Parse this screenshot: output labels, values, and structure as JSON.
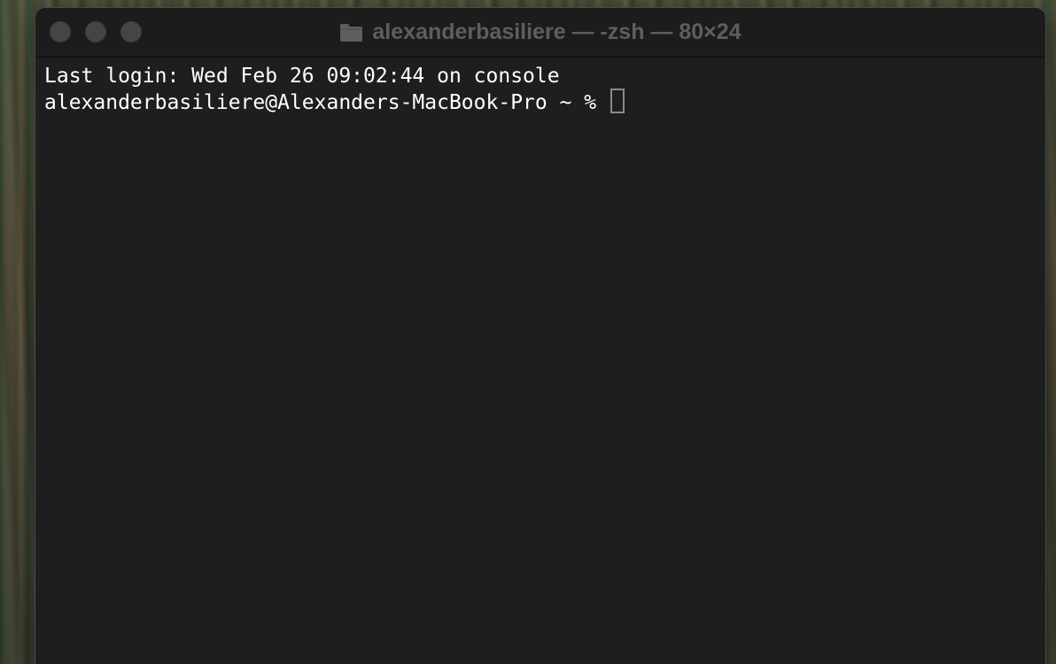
{
  "window": {
    "title": "alexanderbasiliere — -zsh — 80×24",
    "title_icon": "folder-icon",
    "traffic_lights": [
      "close",
      "minimize",
      "zoom"
    ]
  },
  "terminal": {
    "lines": [
      "Last login: Wed Feb 26 09:02:44 on console",
      "alexanderbasiliere@Alexanders-MacBook-Pro ~ % "
    ]
  },
  "colors": {
    "background": "#1e1e1e",
    "text": "#ffffff",
    "title_text": "#5e5e5e",
    "traffic_light": "#454545"
  }
}
